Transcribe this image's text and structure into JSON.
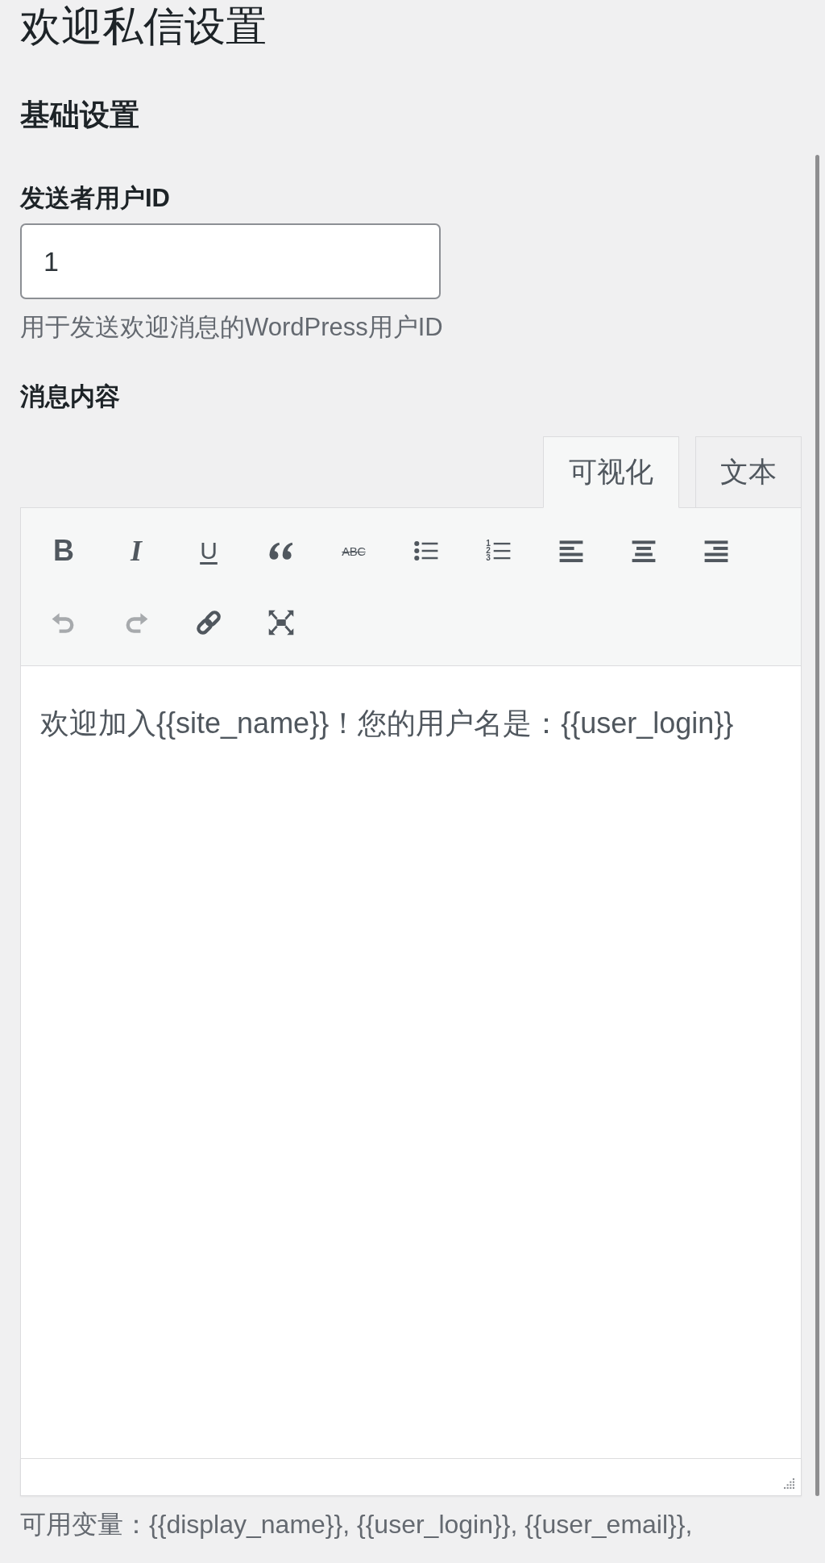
{
  "page_title": "欢迎私信设置",
  "section_title": "基础设置",
  "sender_field": {
    "label": "发送者用户ID",
    "value": "1",
    "help": "用于发送欢迎消息的WordPress用户ID"
  },
  "message": {
    "label": "消息内容",
    "editor_tabs": [
      {
        "label": "可视化",
        "selected": true
      },
      {
        "label": "文本",
        "selected": false
      }
    ],
    "toolbar_rows": [
      [
        {
          "kind": "bold",
          "label": "B",
          "disabled": false
        },
        {
          "kind": "italic",
          "label": "I",
          "disabled": false
        },
        {
          "kind": "underline",
          "label": "U",
          "disabled": false
        },
        {
          "kind": "blockquote",
          "disabled": false
        },
        {
          "kind": "strikethrough",
          "label": "ABC",
          "disabled": false
        },
        {
          "kind": "bullet_list",
          "disabled": false
        },
        {
          "kind": "numbered_list",
          "numbers": [
            "1",
            "2",
            "3"
          ],
          "disabled": false
        },
        {
          "kind": "align_left",
          "disabled": false
        },
        {
          "kind": "align_center",
          "disabled": false
        },
        {
          "kind": "align_right",
          "disabled": false
        }
      ],
      [
        {
          "kind": "undo",
          "disabled": true
        },
        {
          "kind": "redo",
          "disabled": true
        },
        {
          "kind": "link",
          "disabled": false
        },
        {
          "kind": "fullscreen",
          "disabled": false
        }
      ]
    ],
    "content": "欢迎加入{{site_name}}！您的用户名是：{{user_login}}",
    "variables_note": "可用变量：{{display_name}}, {{user_login}}, {{user_email}},"
  }
}
